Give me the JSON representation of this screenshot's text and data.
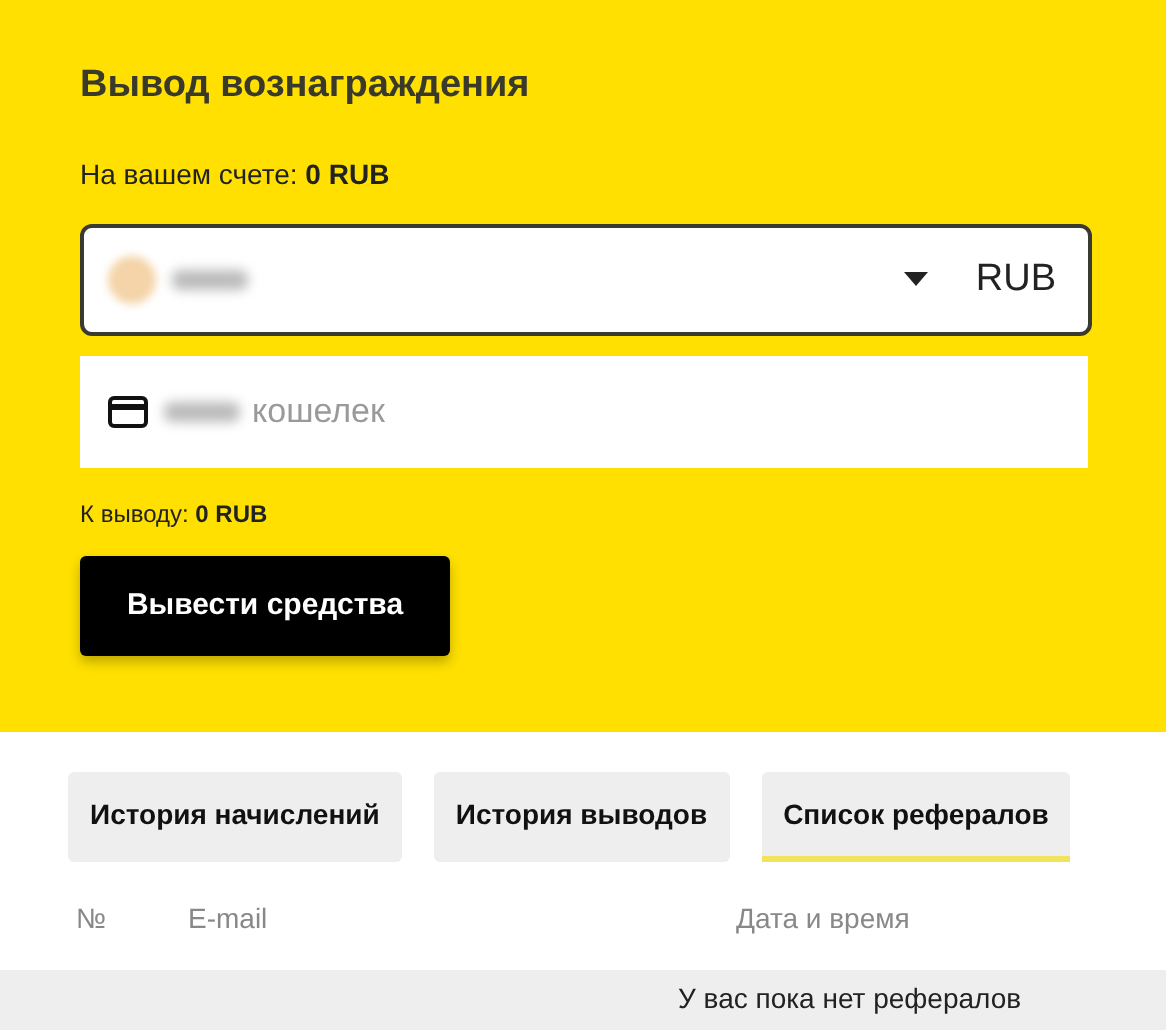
{
  "title": "Вывод вознаграждения",
  "balance": {
    "label": "На вашем счете:",
    "value": "0 RUB"
  },
  "method_select": {
    "currency": "RUB",
    "value_blurred": true
  },
  "wallet_field": {
    "placeholder": "кошелек",
    "prefix_blurred": true
  },
  "payout": {
    "label": "К выводу:",
    "value": "0 RUB"
  },
  "submit_button": "Вывести средства",
  "tabs": [
    {
      "label": "История начислений",
      "selected": false
    },
    {
      "label": "История выводов",
      "selected": false
    },
    {
      "label": "Список рефералов",
      "selected": true
    }
  ],
  "table": {
    "columns": [
      "№",
      "E-mail",
      "Дата и время"
    ],
    "empty_message": "У вас пока нет рефералов"
  }
}
